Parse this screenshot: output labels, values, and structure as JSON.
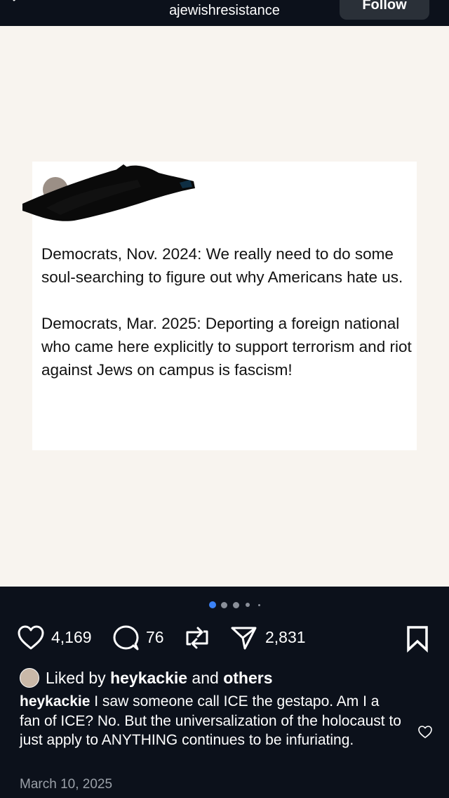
{
  "header": {
    "username": "ajewishresistance",
    "follow_label": "Follow"
  },
  "tweet": {
    "paragraphs": [
      "Democrats, Nov. 2024: We really need to do some soul-searching to figure out why Americans hate us.",
      "Democrats, Mar. 2025: Deporting a foreign national who came here explicitly to support terrorism and riot against Jews on campus is fascism!"
    ]
  },
  "carousel": {
    "count": 5,
    "active_index": 0,
    "active_color": "#3b82f6"
  },
  "actions": {
    "likes": "4,169",
    "comments": "76",
    "shares": "2,831"
  },
  "liked_by": {
    "prefix": "Liked by ",
    "user": "heykackie",
    "middle": " and ",
    "others": "others"
  },
  "caption": {
    "user": "heykackie",
    "text": " I saw someone call ICE the gestapo. Am I a fan of ICE? No. But the universalization of the holocaust to just apply to ANYTHING continues to be infuriating."
  },
  "date": "March 10, 2025",
  "icons": [
    "back-icon",
    "heart-icon",
    "comment-icon",
    "repost-icon",
    "share-icon",
    "bookmark-icon",
    "heart-outline-icon"
  ]
}
